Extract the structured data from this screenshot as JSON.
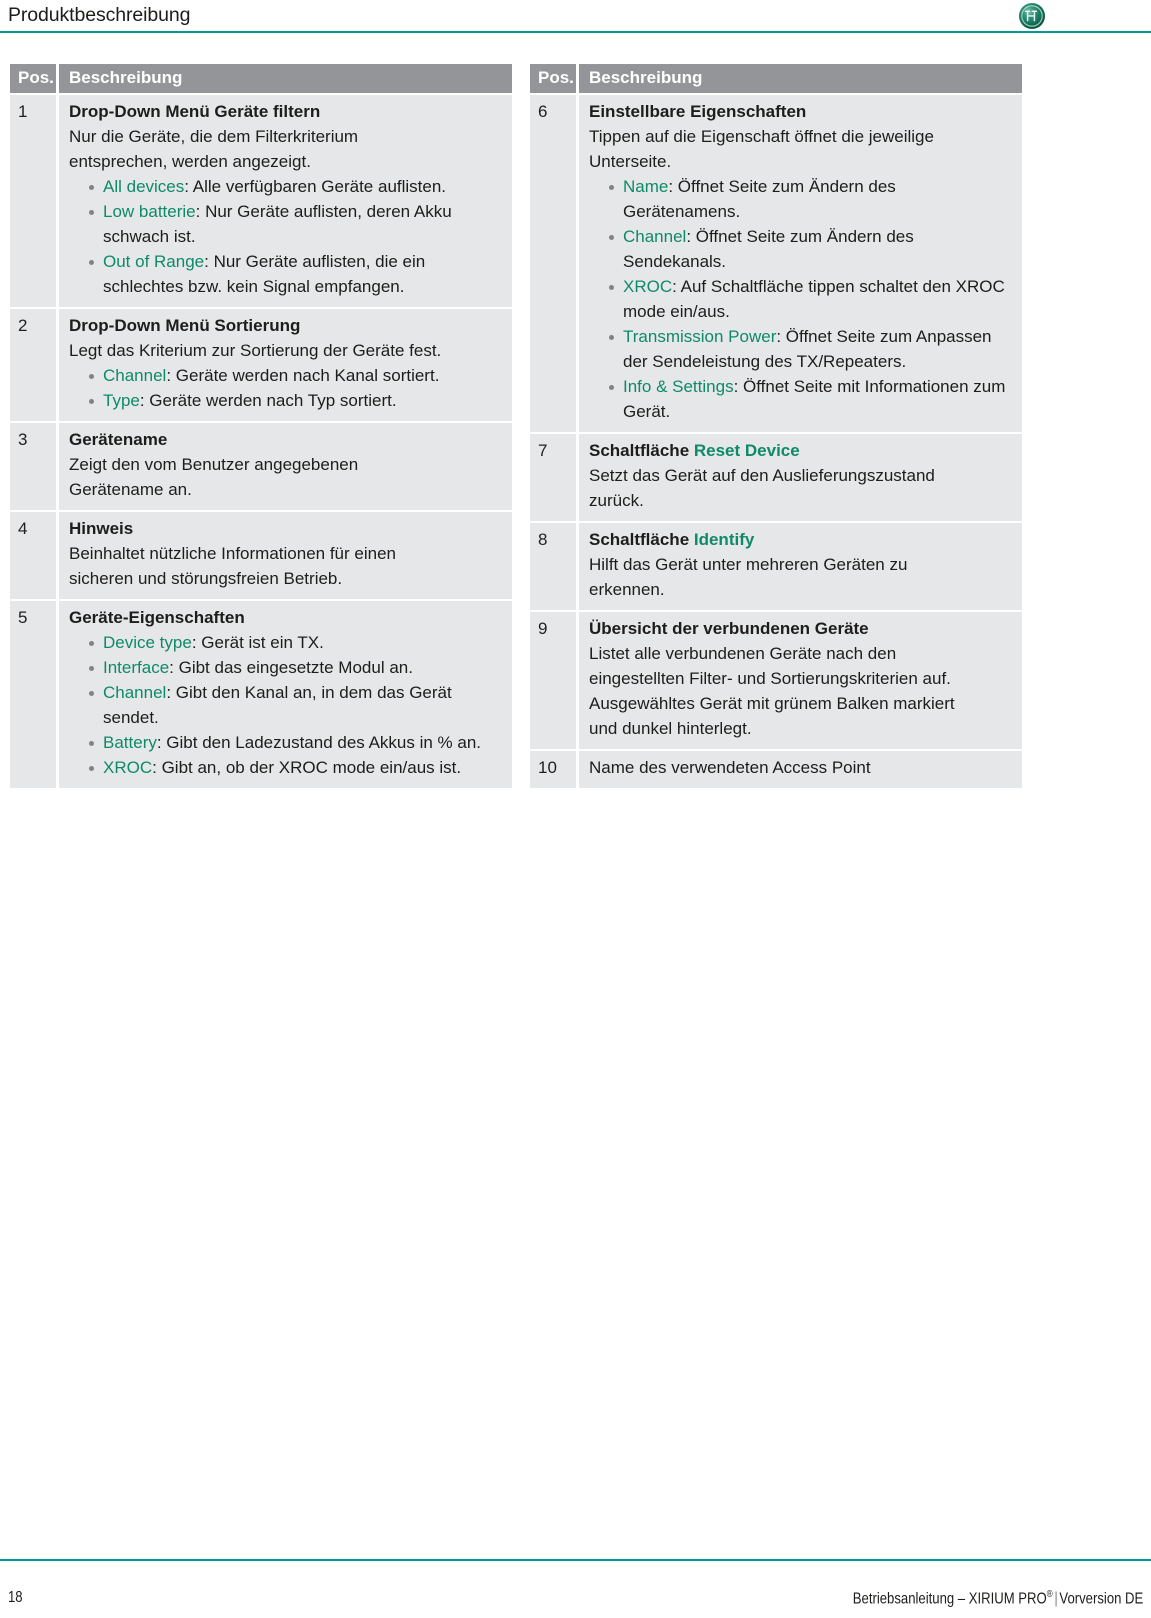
{
  "header": {
    "running_title": "Produktbeschreibung",
    "logo_name": "xirium-pro-logo",
    "rule_color": "#009b9b"
  },
  "colors": {
    "accent_teal": "#009b9b",
    "accent_green": "#0f8a68",
    "table_header_gray": "#939598",
    "table_row_gray": "#e6e7e8",
    "text": "#1d1d1b"
  },
  "tables": {
    "left": {
      "columns": [
        "Pos.",
        "Beschreibung"
      ],
      "rows": [
        {
          "pos": "1",
          "title": "Drop-Down Menü Geräte filtern",
          "intro": [
            "Nur die Geräte, die dem Filterkriterium",
            "entsprechen, werden angezeigt."
          ],
          "items": [
            {
              "term": "All devices",
              "text": ": Alle verfügbaren Geräte auflisten."
            },
            {
              "term": "Low batterie",
              "text": ": Nur Geräte auflisten, deren Akku schwach ist."
            },
            {
              "term": "Out of Range",
              "text": ": Nur Geräte auflisten, die ein schlechtes bzw. kein Signal empfangen."
            }
          ]
        },
        {
          "pos": "2",
          "title": "Drop-Down Menü Sortierung",
          "intro": [
            "Legt das Kriterium zur Sortierung der Geräte fest."
          ],
          "items": [
            {
              "term": "Channel",
              "text": ": Geräte werden nach Kanal sortiert."
            },
            {
              "term": "Type",
              "text": ": Geräte werden nach Typ sortiert."
            }
          ]
        },
        {
          "pos": "3",
          "title": "Gerätename",
          "intro": [
            "Zeigt den vom Benutzer angegebenen",
            "Gerätename an."
          ],
          "items": []
        },
        {
          "pos": "4",
          "title": "Hinweis",
          "intro": [
            "Beinhaltet nützliche Informationen für einen",
            "sicheren und störungsfreien Betrieb."
          ],
          "items": []
        },
        {
          "pos": "5",
          "title": "Geräte-Eigenschaften",
          "intro": [],
          "items": [
            {
              "term": "Device type",
              "text": ": Gerät ist ein TX."
            },
            {
              "term": "Interface",
              "text": ": Gibt das eingesetzte Modul an."
            },
            {
              "term": "Channel",
              "text": ": Gibt den Kanal an, in dem das Gerät sendet."
            },
            {
              "term": "Battery",
              "text": ": Gibt den Ladezustand des Akkus in % an."
            },
            {
              "term": "XROC",
              "text": ": Gibt an, ob der XROC mode ein/aus ist."
            }
          ]
        }
      ]
    },
    "right": {
      "columns": [
        "Pos.",
        "Beschreibung"
      ],
      "rows": [
        {
          "pos": "6",
          "title": "Einstellbare Eigenschaften",
          "intro": [
            "Tippen auf die Eigenschaft öffnet die jeweilige",
            "Unterseite."
          ],
          "items": [
            {
              "term": "Name",
              "text": ": Öffnet Seite zum Ändern des Gerätenamens."
            },
            {
              "term": "Channel",
              "text": ": Öffnet Seite zum Ändern des Sendekanals."
            },
            {
              "term": "XROC",
              "text": ": Auf Schaltfläche tippen schaltet den XROC mode ein/aus."
            },
            {
              "term": "Transmission Power",
              "text": ": Öffnet Seite zum Anpassen der Sendeleistung des TX/Repeaters."
            },
            {
              "term": "Info & Settings",
              "text": ": Öffnet Seite mit Informationen zum Gerät."
            }
          ]
        },
        {
          "pos": "7",
          "title_prefix": "Schaltfläche ",
          "title_term": "Reset Device",
          "intro": [
            "Setzt das Gerät auf den Auslieferungszustand",
            "zurück."
          ],
          "items": []
        },
        {
          "pos": "8",
          "title_prefix": "Schaltfläche ",
          "title_term": "Identify",
          "intro": [
            "Hilft das Gerät unter mehreren Geräten zu",
            "erkennen."
          ],
          "items": []
        },
        {
          "pos": "9",
          "title": "Übersicht der verbundenen Geräte",
          "intro": [
            "Listet alle verbundenen Geräte nach den",
            "eingestellten Filter- und Sortierungskriterien auf.",
            "Ausgewähltes Gerät mit grünem Balken markiert",
            "und dunkel hinterlegt."
          ],
          "items": []
        },
        {
          "pos": "10",
          "title": "",
          "intro": [
            "Name des verwendeten Access Point"
          ],
          "items": []
        }
      ]
    }
  },
  "footer": {
    "page_number": "18",
    "doc_label": "Betriebsanleitung – XIRIUM PRO",
    "doc_registered": "®",
    "separator": "|",
    "doc_version": "Vorversion DE"
  }
}
